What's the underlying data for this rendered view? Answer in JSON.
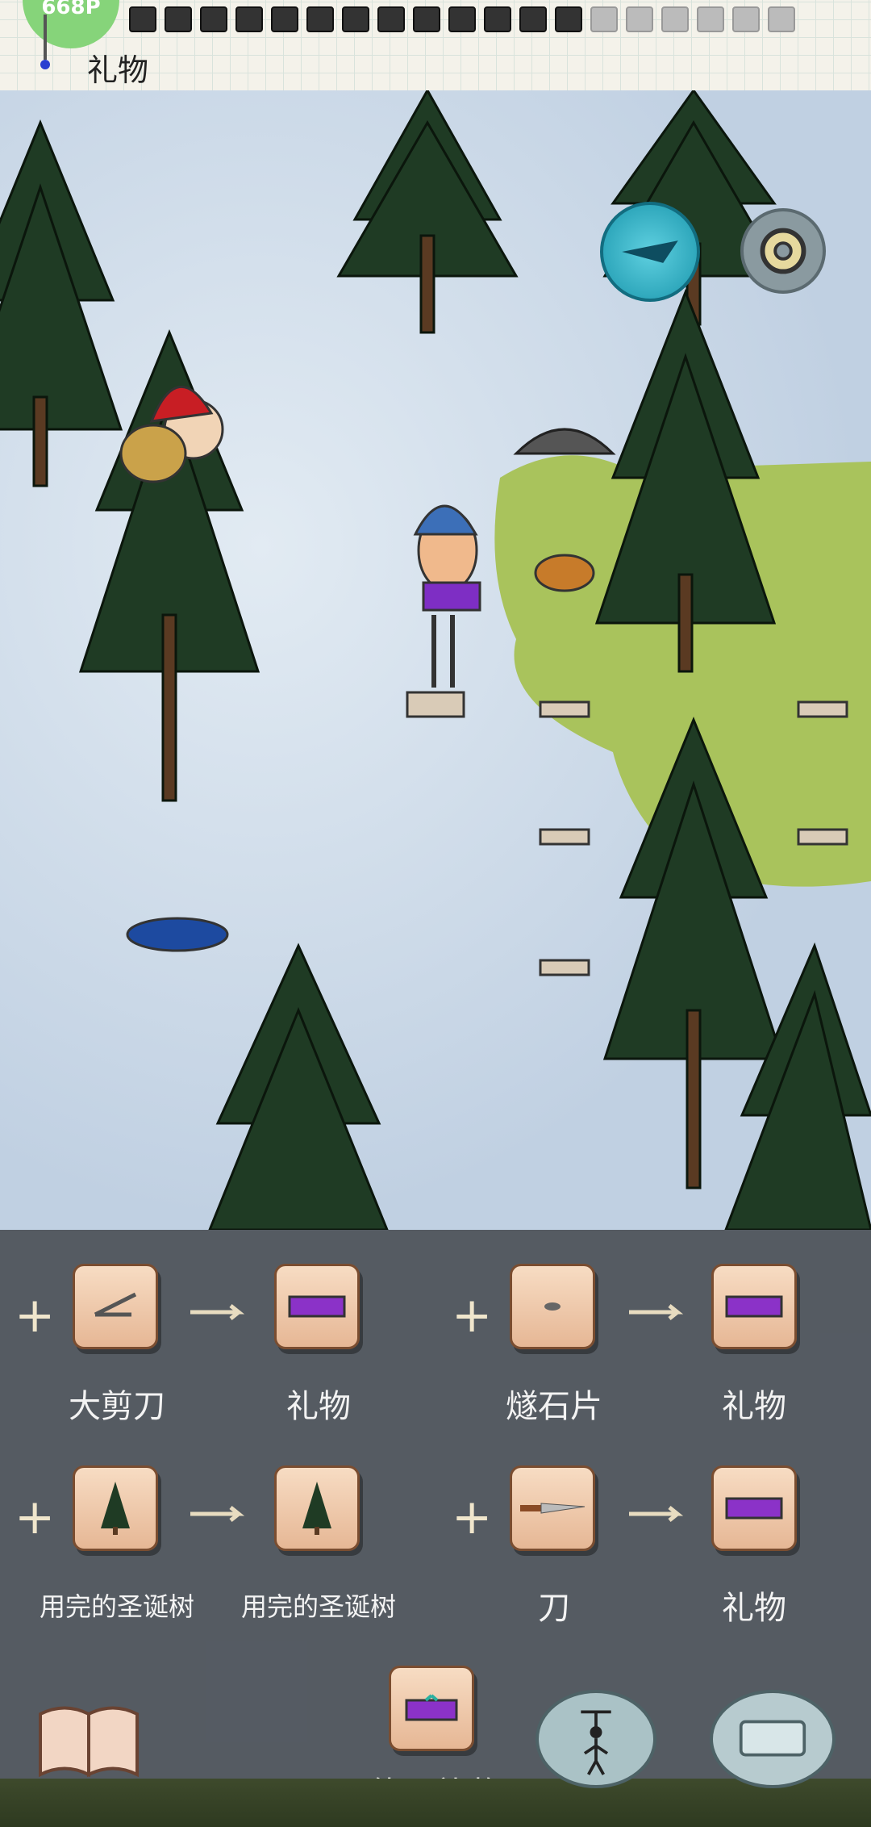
{
  "hud": {
    "food_count": "668P",
    "holding_item": "礼物",
    "hunger_boxes": 19,
    "hunger_faded": 6
  },
  "buttons": {
    "compass_icon": "compass-icon",
    "settings_icon": "gear-icon"
  },
  "recipes": [
    {
      "ingredient": "大剪刀",
      "result": "礼物"
    },
    {
      "ingredient": "燧石片",
      "result": "礼物"
    },
    {
      "ingredient": "用完的圣诞树",
      "result": "用完的圣诞树"
    },
    {
      "ingredient": "刀",
      "result": "礼物"
    }
  ],
  "use_action": {
    "label": "使用礼物"
  },
  "bottom_buttons": {
    "book_icon": "book-icon",
    "puppet_icon": "puppet-icon",
    "keyboard_icon": "keyboard-icon"
  },
  "colors": {
    "tile_bg": "#f0c9a8",
    "panel_bg": "#3c4046",
    "snow": "#c8d6e6",
    "grass": "#a8c25a",
    "tree": "#1f3b24"
  }
}
